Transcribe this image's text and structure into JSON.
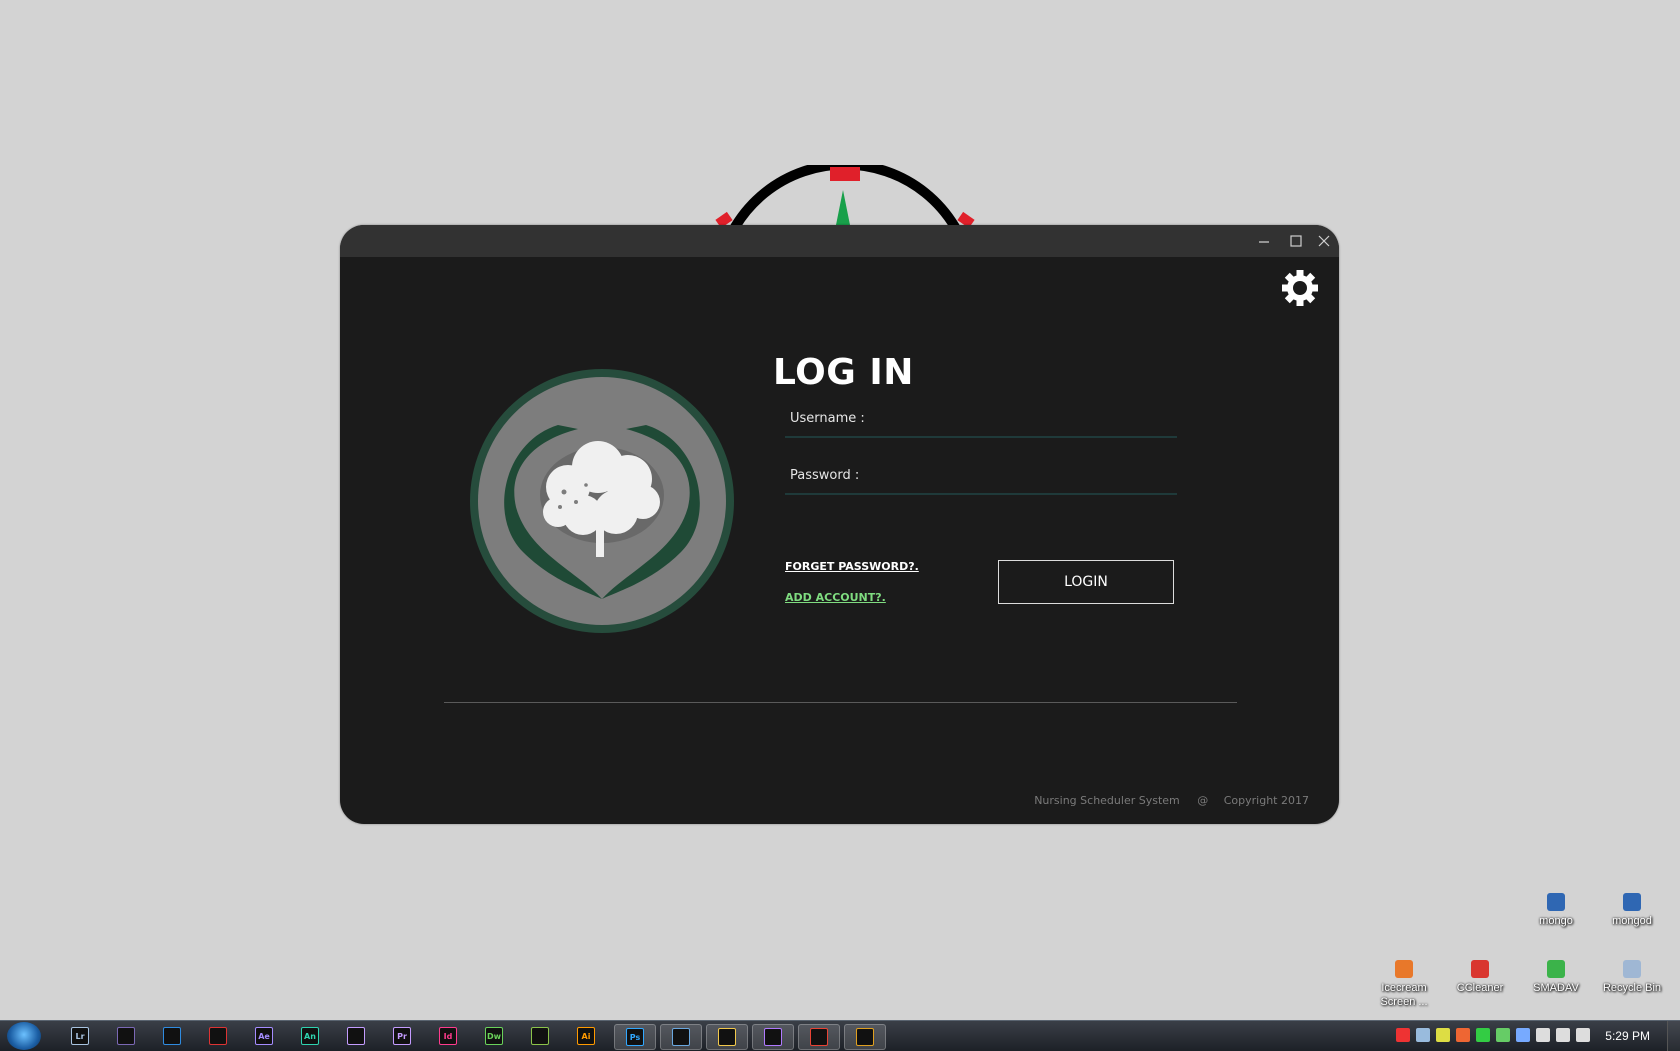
{
  "window": {
    "title_buttons": {
      "minimize_icon": "minimize-icon",
      "maximize_icon": "maximize-icon",
      "close_icon": "close-icon"
    },
    "settings_icon": "gear-icon"
  },
  "login": {
    "title": "LOG IN",
    "username_label": "Username :",
    "username_value": "",
    "password_label": "Password :",
    "password_value": "",
    "forget_password": "FORGET PASSWORD?.",
    "add_account": "ADD ACCOUNT?.",
    "login_button": "LOGIN"
  },
  "footer": {
    "app_name": "Nursing Scheduler System",
    "symbol": "@",
    "copyright": "Copyright 2017"
  },
  "desktop_icons": [
    {
      "label": "mongo",
      "color": "#2f67b3"
    },
    {
      "label": "mongod",
      "color": "#2f67b3"
    },
    {
      "label": "Icecream Screen ...",
      "color": "#e8782a"
    },
    {
      "label": "CCleaner",
      "color": "#d9362f"
    },
    {
      "label": "SMADAV",
      "color": "#3bb34a"
    },
    {
      "label": "Recycle Bin",
      "color": "#9fb7d4"
    }
  ],
  "taskbar": {
    "apps": [
      {
        "name": "lightroom",
        "text": "Lr",
        "color": "#a8c3e0"
      },
      {
        "name": "eclipse",
        "text": "",
        "color": "#7b68b5"
      },
      {
        "name": "vscode",
        "text": "",
        "color": "#2f8be0"
      },
      {
        "name": "pen-tool",
        "text": "",
        "color": "#d33"
      },
      {
        "name": "after-effects",
        "text": "Ae",
        "color": "#a58cff"
      },
      {
        "name": "animate",
        "text": "An",
        "color": "#2fd3b0"
      },
      {
        "name": "premiere-rush",
        "text": "",
        "color": "#c49cff"
      },
      {
        "name": "premiere",
        "text": "Pr",
        "color": "#c49cff"
      },
      {
        "name": "indesign",
        "text": "Id",
        "color": "#ff3b8d"
      },
      {
        "name": "dreamweaver",
        "text": "Dw",
        "color": "#6ad25a"
      },
      {
        "name": "android-studio",
        "text": "",
        "color": "#8bc34a"
      },
      {
        "name": "illustrator",
        "text": "Ai",
        "color": "#ff9a00"
      }
    ],
    "running": [
      {
        "name": "photoshop",
        "text": "Ps",
        "color": "#31a8ff"
      },
      {
        "name": "app-window",
        "text": "",
        "color": "#6aa8e0"
      },
      {
        "name": "file-explorer",
        "text": "",
        "color": "#f2c94c"
      },
      {
        "name": "visual-studio",
        "text": "",
        "color": "#b07aff"
      },
      {
        "name": "chrome",
        "text": "",
        "color": "#e94335"
      },
      {
        "name": "scheduler-app",
        "text": "",
        "color": "#e0a020"
      }
    ],
    "clock": "5:29 PM"
  }
}
